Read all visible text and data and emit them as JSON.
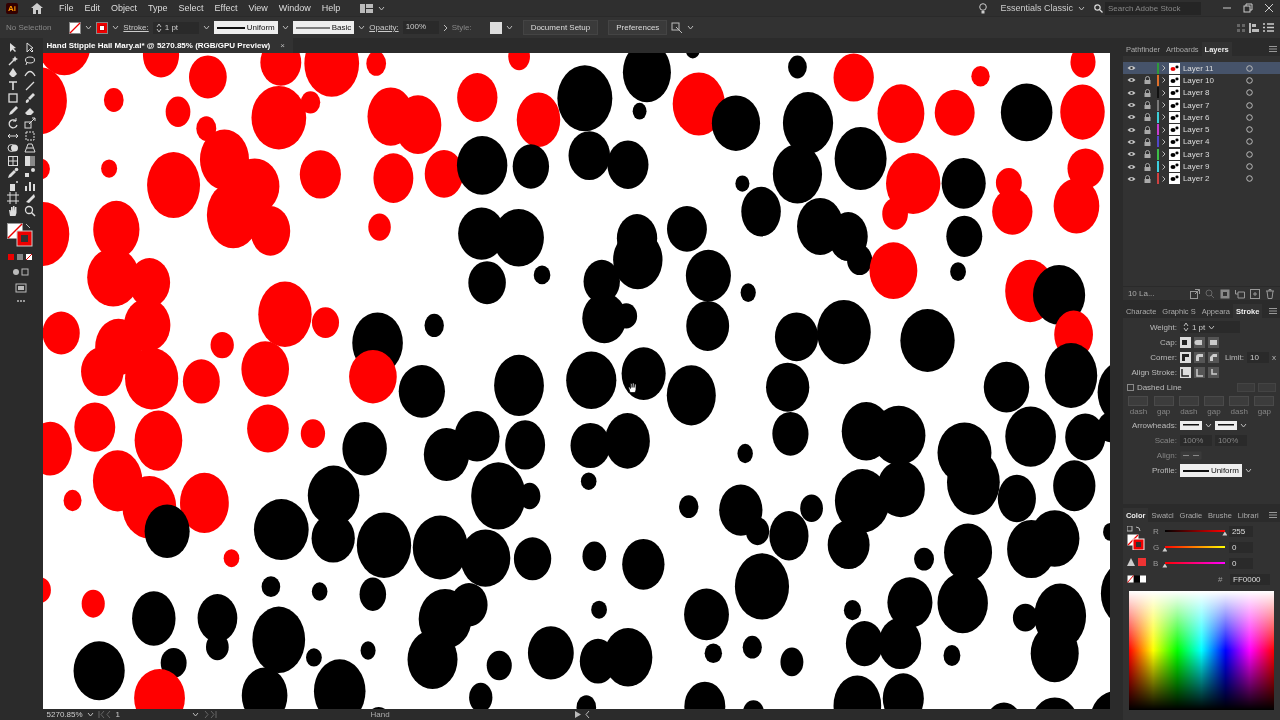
{
  "app": {
    "logo": "Ai",
    "menu": [
      "File",
      "Edit",
      "Object",
      "Type",
      "Select",
      "Effect",
      "View",
      "Window",
      "Help"
    ],
    "workspace": "Essentials Classic",
    "search": {
      "placeholder": "Search Adobe Stock"
    }
  },
  "control_bar": {
    "selection": "No Selection",
    "stroke_label": "Stroke:",
    "stroke_weight": "1 pt",
    "profile": "Uniform",
    "brush": "Basic",
    "opacity_label": "Opacity:",
    "opacity": "100%",
    "style_label": "Style:",
    "buttons": [
      "Document Setup",
      "Preferences"
    ]
  },
  "document_tab": {
    "title": "Hand Stipple Hail Mary.ai* @ 5270.85% (RGB/GPU Preview)",
    "close": "×"
  },
  "layers_panel": {
    "tabs": [
      {
        "label": "Pathfinder",
        "selected": false
      },
      {
        "label": "Artboards",
        "selected": false
      },
      {
        "label": "Layers",
        "selected": true
      }
    ],
    "layers": [
      {
        "name": "Layer 11",
        "color": "#2e9a3a",
        "locked": false,
        "selected": true
      },
      {
        "name": "Layer 10",
        "color": "#e0702a",
        "locked": true,
        "selected": false
      },
      {
        "name": "Layer 8",
        "color": "#111111",
        "locked": true,
        "selected": false
      },
      {
        "name": "Layer 7",
        "color": "#7a7a7a",
        "locked": true,
        "selected": false
      },
      {
        "name": "Layer 6",
        "color": "#3ccfd8",
        "locked": true,
        "selected": false
      },
      {
        "name": "Layer 5",
        "color": "#c83cd0",
        "locked": true,
        "selected": false
      },
      {
        "name": "Layer 4",
        "color": "#5048c8",
        "locked": true,
        "selected": false
      },
      {
        "name": "Layer 3",
        "color": "#3cbf48",
        "locked": true,
        "selected": false
      },
      {
        "name": "Layer 9",
        "color": "#3cd0e0",
        "locked": true,
        "selected": false
      },
      {
        "name": "Layer 2",
        "color": "#d04040",
        "locked": true,
        "selected": false
      }
    ],
    "count": "10 La..."
  },
  "stroke_panel": {
    "tabs": [
      {
        "label": "Characte",
        "selected": false
      },
      {
        "label": "Graphic S",
        "selected": false
      },
      {
        "label": "Appeara",
        "selected": false
      },
      {
        "label": "Stroke",
        "selected": true
      }
    ],
    "weight_label": "Weight:",
    "weight": "1 pt",
    "cap_label": "Cap:",
    "corner_label": "Corner:",
    "limit_label": "Limit:",
    "limit": "10",
    "limit_unit": "x",
    "align_label": "Align Stroke:",
    "dashed": {
      "label": "Dashed Line",
      "checked": false
    },
    "dashes": {
      "disabled": true,
      "labels": [
        "dash",
        "gap",
        "dash",
        "gap",
        "dash",
        "gap"
      ]
    },
    "arrowheads_label": "Arrowheads:",
    "scale": {
      "label": "Scale:",
      "values": [
        "100%",
        "100%"
      ],
      "disabled": true
    },
    "arrow_align": {
      "label": "Align:",
      "disabled": true
    },
    "profile_label": "Profile:",
    "profile": "Uniform"
  },
  "color_panel": {
    "tabs": [
      {
        "label": "Color",
        "selected": true
      },
      {
        "label": "Swatcl",
        "selected": false
      },
      {
        "label": "Gradie",
        "selected": false
      },
      {
        "label": "Brushe",
        "selected": false
      },
      {
        "label": "Librari",
        "selected": false
      }
    ],
    "channels": [
      {
        "name": "R",
        "value": "255",
        "level": 1
      },
      {
        "name": "G",
        "value": "0",
        "level": 0
      },
      {
        "name": "B",
        "value": "0",
        "level": 0
      }
    ],
    "hex_label": "#",
    "hex": "FF0000"
  },
  "status_bar": {
    "zoom": "5270.85%",
    "artboard": "1",
    "tool": "Hand"
  }
}
